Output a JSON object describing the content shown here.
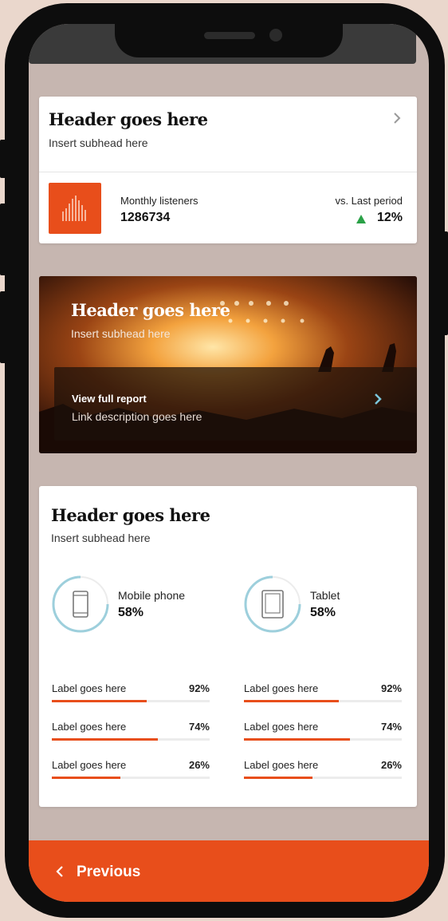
{
  "summary_card": {
    "title": "Header goes here",
    "subtitle": "Insert subhead here",
    "metric_label": "Monthly listeners",
    "metric_value": "1286734",
    "compare_label": "vs. Last period",
    "compare_value": "12%",
    "trend": "up",
    "accent_color": "#e84e1b",
    "trend_color": "#2aa147"
  },
  "report_card": {
    "title": "Header goes here",
    "subtitle": "Insert subhead here",
    "link_label": "View full report",
    "link_description": "Link description goes here",
    "chevron_color": "#7cc7dc"
  },
  "devices_card": {
    "title": "Header goes here",
    "subtitle": "Insert subhead here",
    "ring_color": "#9dcfdc",
    "devices": [
      {
        "label": "Mobile phone",
        "value": "58%",
        "icon": "mobile-phone-icon"
      },
      {
        "label": "Tablet",
        "value": "58%",
        "icon": "tablet-icon"
      }
    ],
    "bars_left": [
      {
        "label": "Label goes here",
        "pct": "92%"
      },
      {
        "label": "Label goes here",
        "pct": "74%"
      },
      {
        "label": "Label goes here",
        "pct": "26%"
      }
    ],
    "bars_right": [
      {
        "label": "Label goes here",
        "pct": "92%"
      },
      {
        "label": "Label goes here",
        "pct": "74%"
      },
      {
        "label": "Label goes here",
        "pct": "26%"
      }
    ]
  },
  "footer": {
    "previous_label": "Previous",
    "background": "#e84e1b"
  }
}
